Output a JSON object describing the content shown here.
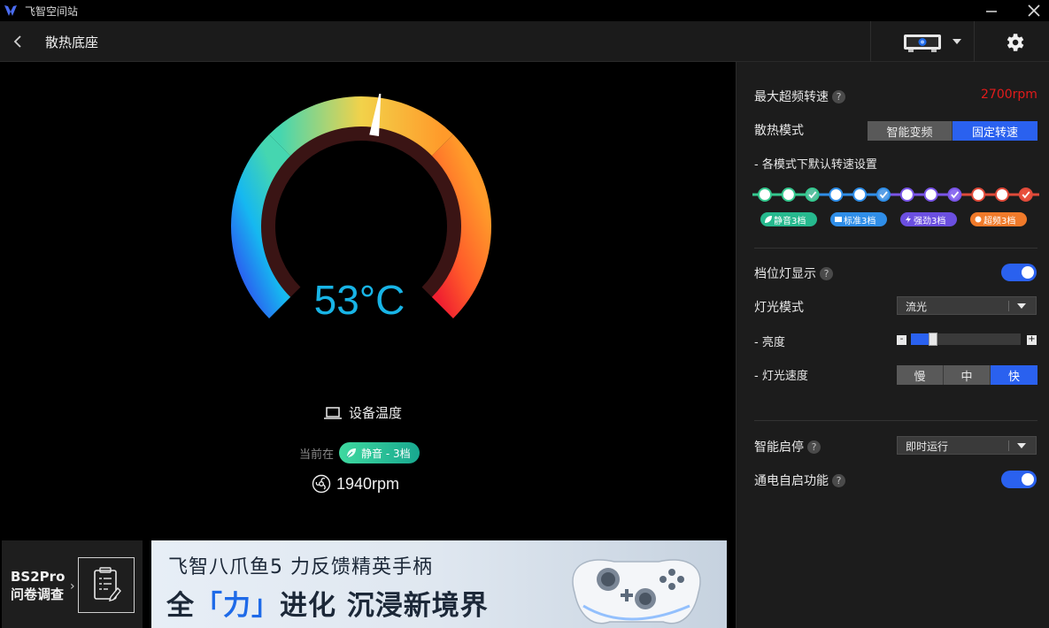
{
  "app": {
    "title": "飞智空间站"
  },
  "header": {
    "title": "散热底座",
    "device_caret_icon": "caret-down-icon"
  },
  "gauge": {
    "temperature": "53°C",
    "temperature_value": 53,
    "label": "设备温度",
    "current_prefix": "当前在",
    "current_mode": "静音 - 3档",
    "rpm": "1940rpm"
  },
  "survey": {
    "line1": "BS2Pro",
    "line2": "问卷调查",
    "chevron": "›"
  },
  "ad": {
    "line1": "飞智八爪鱼5 力反馈精英手柄",
    "line2_a": "全",
    "line2_b": "「力」",
    "line2_c": "进化 沉浸新境界"
  },
  "panel": {
    "max_freq_label": "最大超频转速",
    "max_freq_value": "2700rpm",
    "cool_mode_label": "散热模式",
    "cool_modes": [
      "智能变频",
      "固定转速"
    ],
    "cool_mode_active": 1,
    "defaults_label": "- 各模式下默认转速设置",
    "steps": [
      {
        "color": "#35c98f",
        "checked": false
      },
      {
        "color": "#35c98f",
        "checked": false
      },
      {
        "color": "#35c98f",
        "checked": true
      },
      {
        "color": "#2f8ee8",
        "checked": false
      },
      {
        "color": "#2f8ee8",
        "checked": false
      },
      {
        "color": "#2f8ee8",
        "checked": true
      },
      {
        "color": "#7a55e8",
        "checked": false
      },
      {
        "color": "#7a55e8",
        "checked": false
      },
      {
        "color": "#7a55e8",
        "checked": true
      },
      {
        "color": "#e04a3a",
        "checked": false
      },
      {
        "color": "#e04a3a",
        "checked": false
      },
      {
        "color": "#e04a3a",
        "checked": true
      }
    ],
    "tags": [
      {
        "label": "静音3档",
        "color": "#26b98e"
      },
      {
        "label": "标准3档",
        "color": "#2f8ee8"
      },
      {
        "label": "强劲3档",
        "color": "#6b4fe0"
      },
      {
        "label": "超频3档",
        "color": "#f07a2a"
      }
    ],
    "gear_light_label": "档位灯显示",
    "gear_light_on": true,
    "light_mode_label": "灯光模式",
    "light_mode_value": "流光",
    "brightness_label": "- 亮度",
    "brightness_minus": "-",
    "brightness_plus": "+",
    "brightness_level": 0.2,
    "light_speed_label": "- 灯光速度",
    "light_speeds": [
      "慢",
      "中",
      "快"
    ],
    "light_speed_active": 2,
    "smart_start_label": "智能启停",
    "smart_start_value": "即时运行",
    "power_on_label": "通电自启功能",
    "power_on_on": true,
    "help": "?"
  }
}
